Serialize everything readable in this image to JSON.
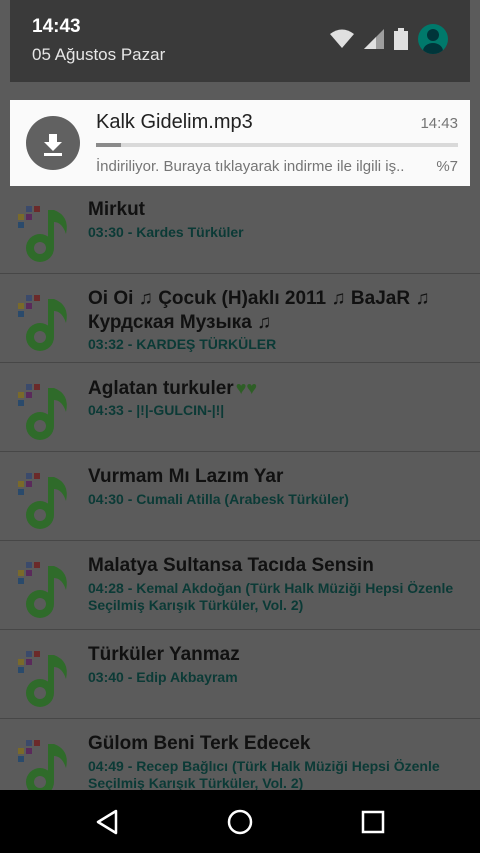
{
  "status": {
    "time": "14:43",
    "date": "05 Ağustos Pazar"
  },
  "notification": {
    "title": "Kalk Gidelim.mp3",
    "time": "14:43",
    "text": "İndiriliyor. Buraya tıklayarak indirme ile ilgili iş..",
    "percent_label": "%7",
    "progress": 0.07
  },
  "songs": [
    {
      "title": "Mirkut",
      "subtitle": "03:30 - Kardes Türküler"
    },
    {
      "title": "Oi Oi ♫ Çocuk (H)aklı 2011 ♫ BaJaR ♫ Курдская Музыка ♫",
      "subtitle": "03:32 - KARDEŞ TÜRKÜLER"
    },
    {
      "title": "Aglatan turkuler",
      "subtitle": "04:33 - |!|-GULCIN-|!|"
    },
    {
      "title": "Vurmam Mı Lazım Yar",
      "subtitle": "04:30 - Cumali Atilla (Arabesk Türküler)"
    },
    {
      "title": "Malatya Sultansa Tacıda Sensin",
      "subtitle": "04:28 - Kemal Akdoğan (Türk Halk Müziği Hepsi Özenle Seçilmiş Karışık Türküler, Vol. 2)"
    },
    {
      "title": "Türküler Yanmaz",
      "subtitle": "03:40 - Edip Akbayram"
    },
    {
      "title": "Gülom Beni Terk Edecek",
      "subtitle": "04:49 - Recep Bağlıcı (Türk Halk Müziği Hepsi Özenle Seçilmiş Karışık Türküler, Vol. 2)"
    }
  ],
  "hearts_text": "♥♥",
  "colors": {
    "accent": "#00796b",
    "icon_green": "#2e7d32"
  },
  "icons": [
    "wifi-icon",
    "signal-icon",
    "battery-icon",
    "account-icon",
    "download-icon",
    "music-note-icon",
    "back-icon",
    "home-icon",
    "recents-icon"
  ]
}
